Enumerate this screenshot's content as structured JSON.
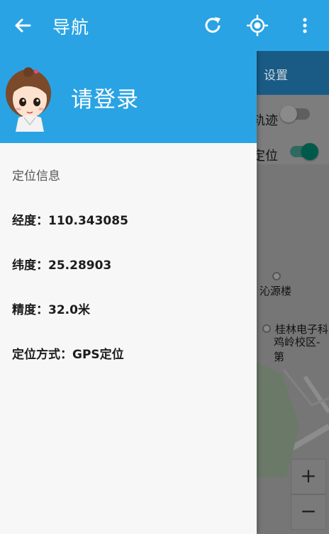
{
  "toolbar": {
    "title": "导航",
    "back_icon": "arrow-left-icon",
    "refresh_icon": "refresh-icon",
    "locate_icon": "my-location-icon",
    "more_icon": "more-vert-icon",
    "bg_color": "#29a3e4"
  },
  "drawer": {
    "login_text": "请登录",
    "section_title": "定位信息",
    "items": [
      {
        "label": "经度：110.343085"
      },
      {
        "label": "纬度：25.28903"
      },
      {
        "label": "精度：32.0米"
      },
      {
        "label": "定位方式：GPS定位"
      }
    ]
  },
  "background": {
    "settings_label": "设置",
    "track_label": "轨迹",
    "locate_label": "定位",
    "track_switch": false,
    "locate_switch": true,
    "poi_1": "沁源楼",
    "poi_2_line1": "桂林电子科",
    "poi_2_line2": "鸡岭校区-第",
    "zoom_in": "+",
    "zoom_out": "−"
  }
}
